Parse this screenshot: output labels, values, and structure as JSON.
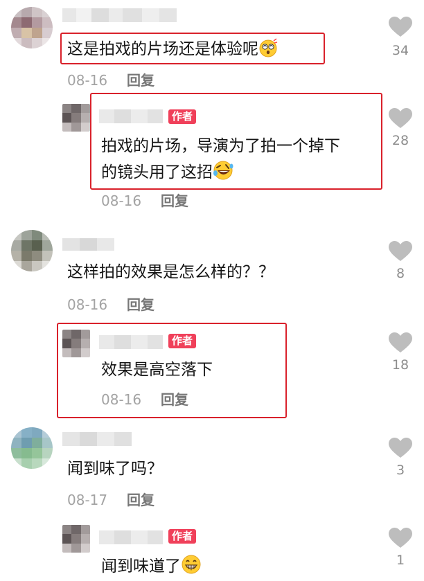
{
  "colors": {
    "accent": "#f0405a",
    "highlight_border": "#d9212b",
    "heart": "#bdbdbd"
  },
  "comments": [
    {
      "text": "这是拍戏的片场还是体验呢",
      "emoji": "dizzy-face-emoji",
      "date": "08-16",
      "reply_label": "回复",
      "likes": "34",
      "replies": [
        {
          "author_tag": "作者",
          "text_line1": "拍戏的片场，导演为了拍一个掉下",
          "text_line2": "的镜头用了这招",
          "emoji": "rolling-laughing-emoji",
          "date": "08-16",
          "reply_label": "回复",
          "likes": "28"
        }
      ]
    },
    {
      "text": "这样拍的效果是怎么样的？？",
      "date": "08-16",
      "reply_label": "回复",
      "likes": "8",
      "replies": [
        {
          "author_tag": "作者",
          "text": "效果是高空落下",
          "date": "08-16",
          "reply_label": "回复",
          "likes": "18"
        }
      ]
    },
    {
      "text": "闻到味了吗？",
      "date": "08-17",
      "reply_label": "回复",
      "likes": "3",
      "replies": [
        {
          "author_tag": "作者",
          "text": "闻到味道了",
          "emoji": "grinning-face-emoji",
          "likes": "1"
        }
      ]
    }
  ]
}
